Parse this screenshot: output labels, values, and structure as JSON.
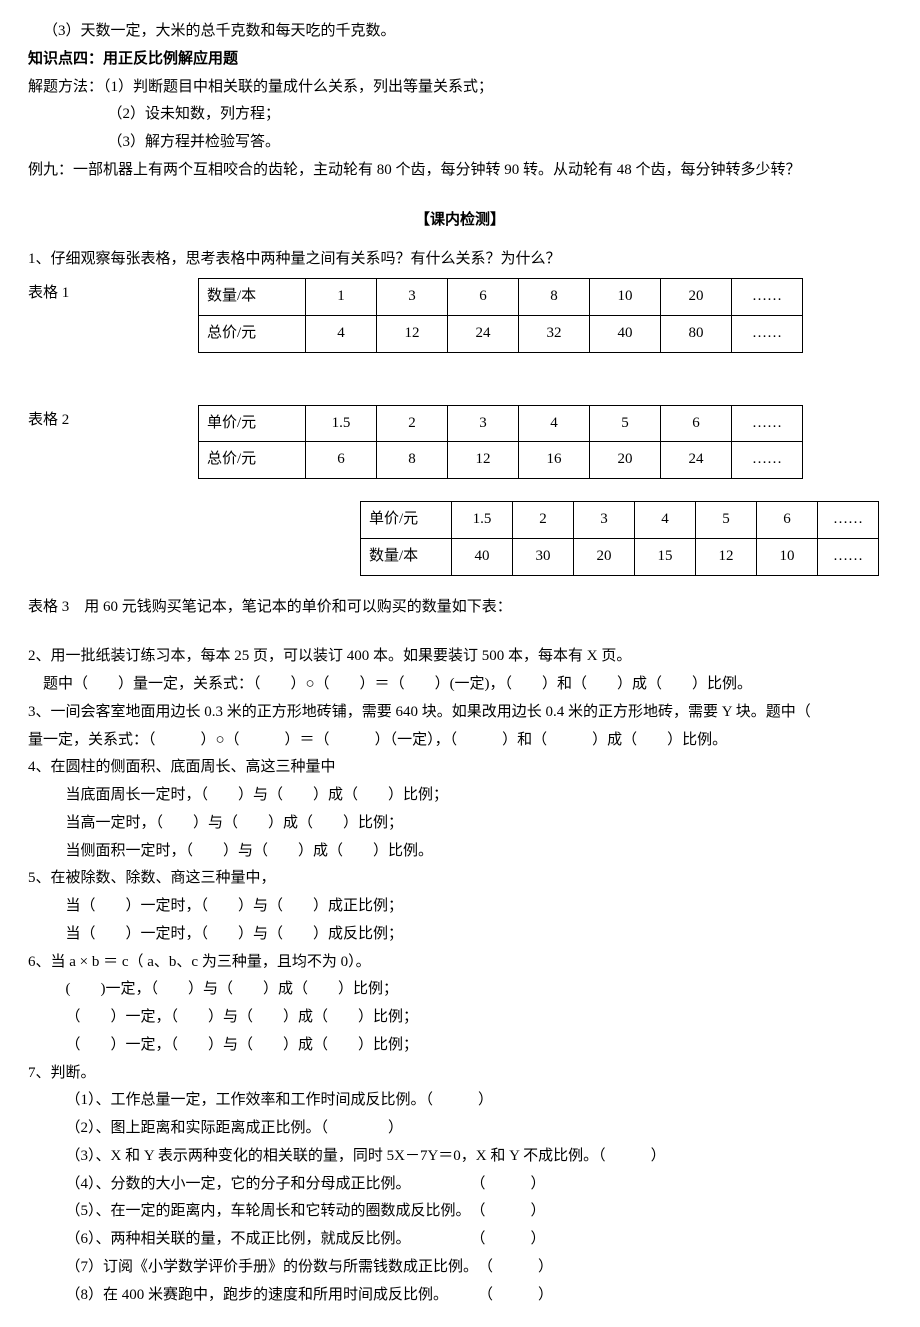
{
  "intro": {
    "l1": "（3）天数一定，大米的总千克数和每天吃的千克数。",
    "kp4_title": "知识点四：用正反比例解应用题",
    "method_lead": "解题方法：（1）判断题目中相关联的量成什么关系，列出等量关系式；",
    "method_2": "（2）设未知数，列方程；",
    "method_3": "（3）解方程并检验写答。",
    "ex9": "例九：一部机器上有两个互相咬合的齿轮，主动轮有 80 个齿，每分钟转 90 转。从动轮有 48 个齿，每分钟转多少转？"
  },
  "sec_title": "【课内检测】",
  "q1": {
    "prompt": "1、仔细观察每张表格，思考表格中两种量之间有关系吗？有什么关系？为什么？",
    "t1_label": "表格 1",
    "t2_label": "表格 2",
    "t3_label": "表格 3　用 60 元钱购买笔记本，笔记本的单价和可以购买的数量如下表：",
    "table1": {
      "r1h": "数量/本",
      "r1": [
        "1",
        "3",
        "6",
        "8",
        "10",
        "20",
        "……"
      ],
      "r2h": "总价/元",
      "r2": [
        "4",
        "12",
        "24",
        "32",
        "40",
        "80",
        "……"
      ]
    },
    "table2": {
      "r1h": "单价/元",
      "r1": [
        "1.5",
        "2",
        "3",
        "4",
        "5",
        "6",
        "……"
      ],
      "r2h": "总价/元",
      "r2": [
        "6",
        "8",
        "12",
        "16",
        "20",
        "24",
        "……"
      ]
    },
    "table3": {
      "r1h": "单价/元",
      "r1": [
        "1.5",
        "2",
        "3",
        "4",
        "5",
        "6",
        "……"
      ],
      "r2h": "数量/本",
      "r2": [
        "40",
        "30",
        "20",
        "15",
        "12",
        "10",
        "……"
      ]
    }
  },
  "q2": {
    "l1": "2、用一批纸装订练习本，每本 25 页，可以装订 400 本。如果要装订 500 本，每本有 X 页。",
    "l2": "题中（　　）量一定，关系式：（　　）○（　　）＝（　　）(一定)，（　　）和（　　）成（　　）比例。"
  },
  "q3": {
    "l1": "3、一间会客室地面用边长 0.3 米的正方形地砖铺，需要 640 块。如果改用边长 0.4 米的正方形地砖，需要 Y 块。题中（　",
    "l2": "量一定，关系式：（　　　）○（　　　）＝（　　　）（一定），（　　　）和（　　　）成（　　）比例。"
  },
  "q4": {
    "l1": "4、在圆柱的侧面积、底面周长、高这三种量中",
    "l2": "当底面周长一定时，（　　）与（　　）成（　　）比例；",
    "l3": "当高一定时，（　　）与（　　）成（　　）比例；",
    "l4": "当侧面积一定时，（　　）与（　　）成（　　）比例。"
  },
  "q5": {
    "l1": "5、在被除数、除数、商这三种量中，",
    "l2": "当（　　）一定时，（　　）与（　　）成正比例；",
    "l3": "当（　　）一定时，（　　）与（　　）成反比例；"
  },
  "q6": {
    "l1": "6、当 a × b ＝ c（ a、b、c 为三种量，且均不为 0）。",
    "l2": "(　　)一定，（　　）与（　　）成（　　）比例；",
    "l3": "（　　）一定，（　　）与（　　）成（　　）比例；",
    "l4": "（　　）一定，（　　）与（　　）成（　　）比例；"
  },
  "q7": {
    "l1": "7、判断。",
    "i1": "（1）、工作总量一定，工作效率和工作时间成反比例。（　　　）",
    "i2": "（2）、图上距离和实际距离成正比例。（　　　　）",
    "i3": "（3）、X 和 Y 表示两种变化的相关联的量，同时 5X－7Y＝0，X 和 Y 不成比例。（　　　）",
    "i4": "（4）、分数的大小一定，它的分子和分母成正比例。　　　　　（　　　）",
    "i5": "（5）、在一定的距离内，车轮周长和它转动的圈数成反比例。　（　　　）",
    "i6": "（6）、两种相关联的量，不成正比例，就成反比例。　　　　　（　　　）",
    "i7": "（7）订阅《小学数学评价手册》的份数与所需钱数成正比例。　（　　　）",
    "i8": "（8）在 400 米赛跑中，跑步的速度和所用时间成反比例。　　　（　　　）"
  }
}
